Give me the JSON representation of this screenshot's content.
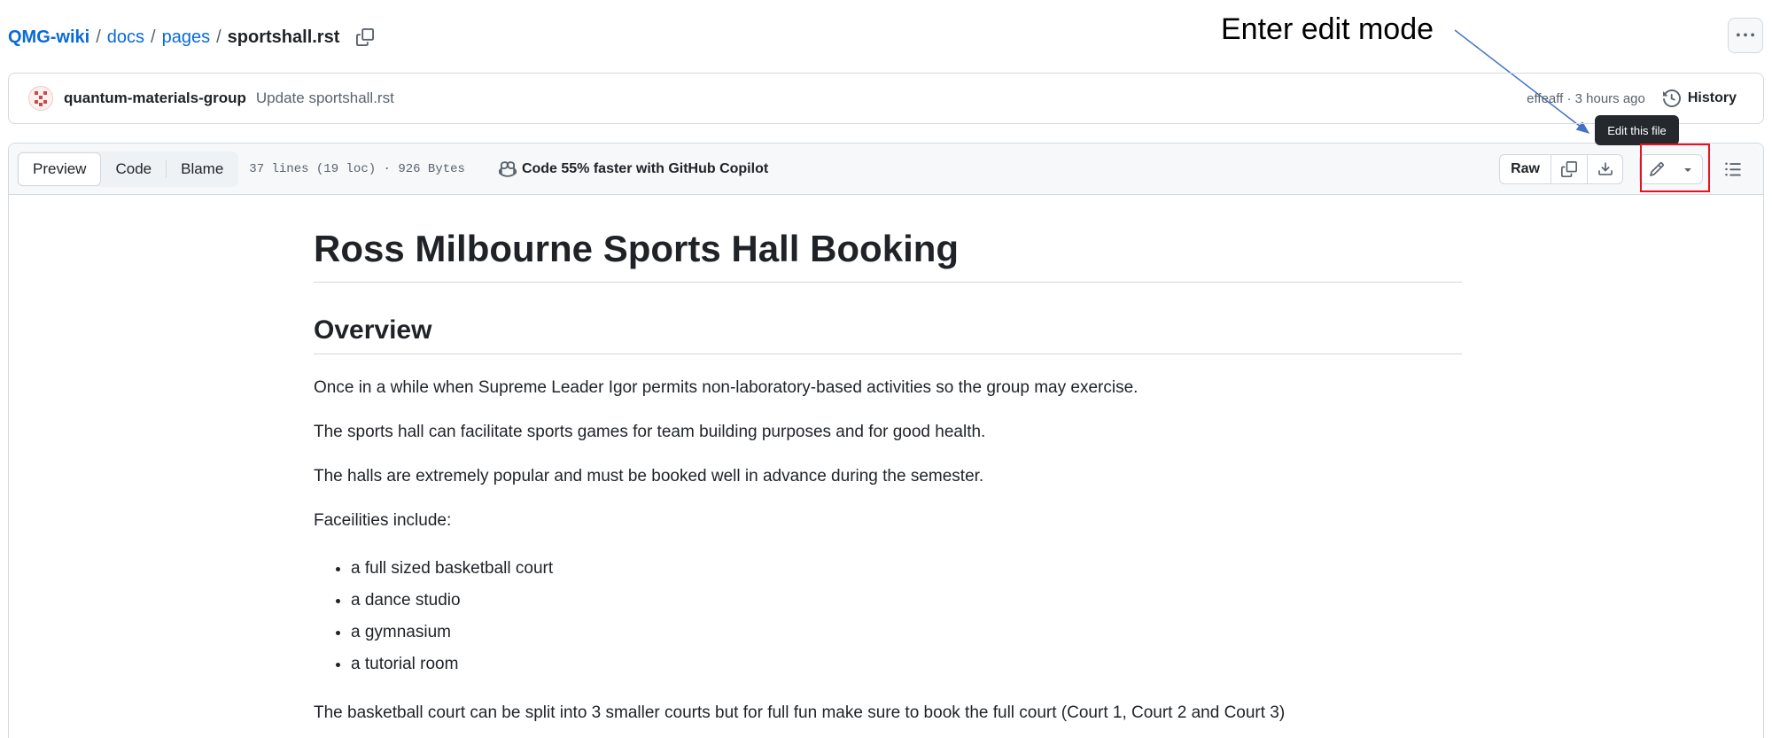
{
  "breadcrumb": {
    "repo": "QMG-wiki",
    "dir1": "docs",
    "dir2": "pages",
    "file": "sportshall.rst",
    "sep": "/"
  },
  "annotation": {
    "label": "Enter edit mode",
    "box_color": "#e81123",
    "arrow_color": "#4472c4"
  },
  "commit": {
    "author": "quantum-materials-group",
    "message": "Update sportshall.rst",
    "meta": "effeaff · 3 hours ago",
    "history_label": "History"
  },
  "tooltip": {
    "text": "Edit this file"
  },
  "file_header": {
    "tabs": [
      "Preview",
      "Code",
      "Blame"
    ],
    "active_tab": "Preview",
    "stats": "37 lines (19 loc) · 926 Bytes",
    "copilot": "Code 55% faster with GitHub Copilot",
    "raw_label": "Raw"
  },
  "content": {
    "title": "Ross Milbourne Sports Hall Booking",
    "section": "Overview",
    "paragraphs": [
      "Once in a while when Supreme Leader Igor permits non-laboratory-based activities so the group may exercise.",
      "The sports hall can facilitate sports games for team building purposes and for good health.",
      "The halls are extremely popular and must be booked well in advance during the semester.",
      "Faceilities include:"
    ],
    "facilities": [
      "a full sized basketball court",
      "a dance studio",
      "a gymnasium",
      "a tutorial room"
    ],
    "closing": "The basketball court can be split into 3 smaller courts but for full fun make sure to book the full court (Court 1, Court 2 and Court 3)"
  },
  "colors": {
    "link": "#0969da",
    "border": "#d1d9e0",
    "header_bg": "#f6f8fa",
    "text": "#1f2328",
    "muted": "#59636e"
  },
  "icons": [
    "copy-icon",
    "kebab-horizontal-icon",
    "history-icon",
    "copilot-icon",
    "download-icon",
    "pencil-icon",
    "triangle-down-icon",
    "list-unordered-icon"
  ]
}
